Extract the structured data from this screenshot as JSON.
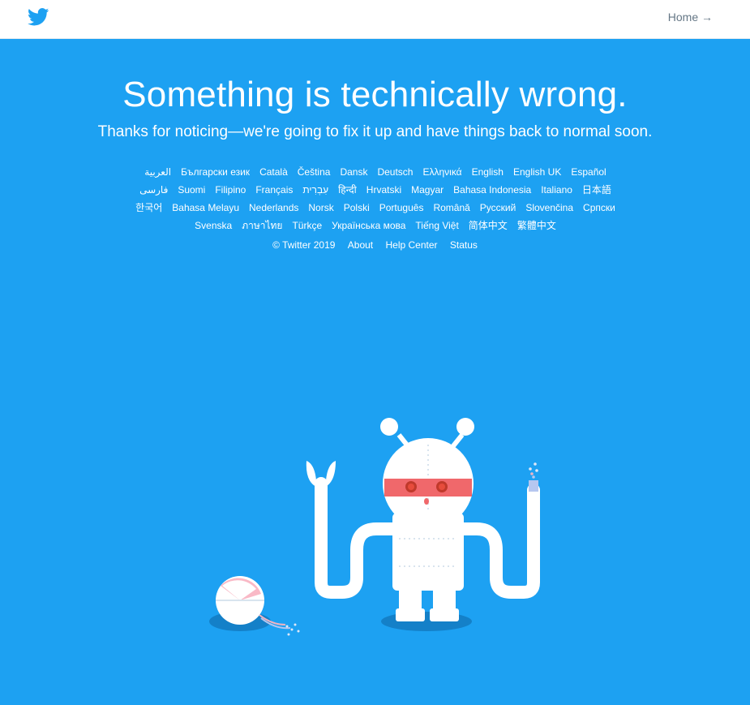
{
  "header": {
    "logo_icon": "twitter-bird-icon",
    "home_link": "Home →"
  },
  "main": {
    "headline": "Something is technically wrong.",
    "subline": "Thanks for noticing—we're going to fix it up and have things back to normal soon."
  },
  "languages": [
    "العربية",
    "Български език",
    "Català",
    "Čeština",
    "Dansk",
    "Deutsch",
    "Ελληνικά",
    "English",
    "English UK",
    "Español",
    "فارسی",
    "Suomi",
    "Filipino",
    "Français",
    "עִבְרִית",
    "हिन्दी",
    "Hrvatski",
    "Magyar",
    "Bahasa Indonesia",
    "Italiano",
    "日本語",
    "한국어",
    "Bahasa Melayu",
    "Nederlands",
    "Norsk",
    "Polski",
    "Português",
    "Română",
    "Русский",
    "Slovenčina",
    "Српски",
    "Svenska",
    "ภาษาไทย",
    "Türkçe",
    "Українська мова",
    "Tiếng Việt",
    "简体中文",
    "繁體中文"
  ],
  "footer": {
    "copyright": "© Twitter 2019",
    "about": "About",
    "help_center": "Help Center",
    "status": "Status"
  },
  "colors": {
    "background": "#1da1f2",
    "brand": "#1da1f2",
    "robot_visor": "#f0686b"
  },
  "illustration": "broken-robot-illustration"
}
